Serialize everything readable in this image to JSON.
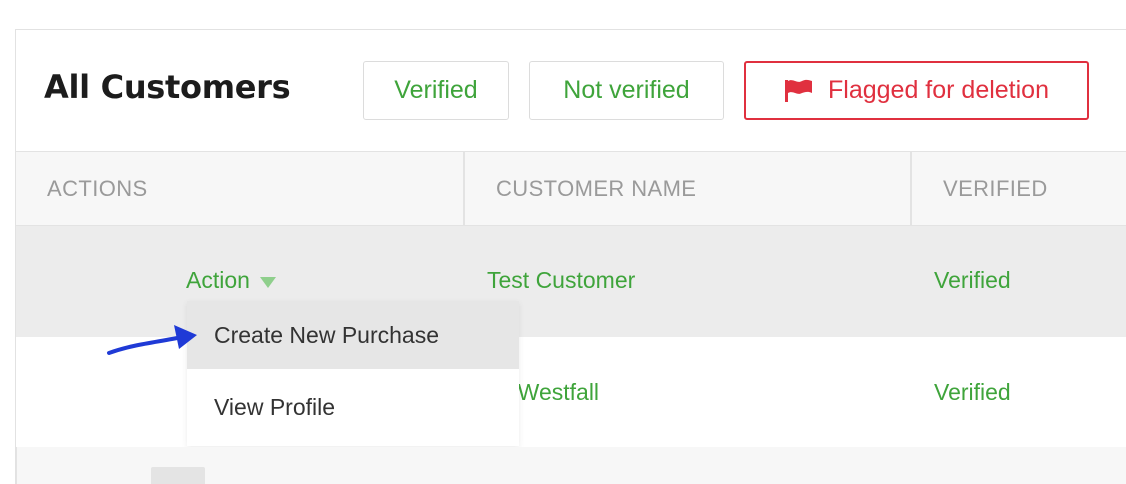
{
  "page": {
    "title": "All Customers"
  },
  "filters": {
    "verified_label": "Verified",
    "not_verified_label": "Not verified",
    "flagged_label": "Flagged for deletion",
    "flagged_icon": "flag-icon"
  },
  "table": {
    "columns": [
      "ACTIONS",
      "CUSTOMER NAME",
      "VERIFIED"
    ],
    "rows": [
      {
        "name": "Test Customer",
        "verified": "Verified"
      },
      {
        "name": "rly Westfall",
        "verified": "Verified"
      }
    ]
  },
  "row_actions": {
    "toggle_label": "Action",
    "toggle_icon": "caret-down-icon",
    "menu_items": [
      "Create New Purchase",
      "View Profile"
    ],
    "highlighted_item": "Create New Purchase"
  },
  "annotation": {
    "type": "arrow",
    "points_to": "Create New Purchase",
    "color": "#1f3ad6"
  },
  "colors": {
    "accent_green": "#3fa43b",
    "danger_red": "#e0303f",
    "title_dark": "#1c1c1c",
    "header_text": "#9a9a9a"
  }
}
